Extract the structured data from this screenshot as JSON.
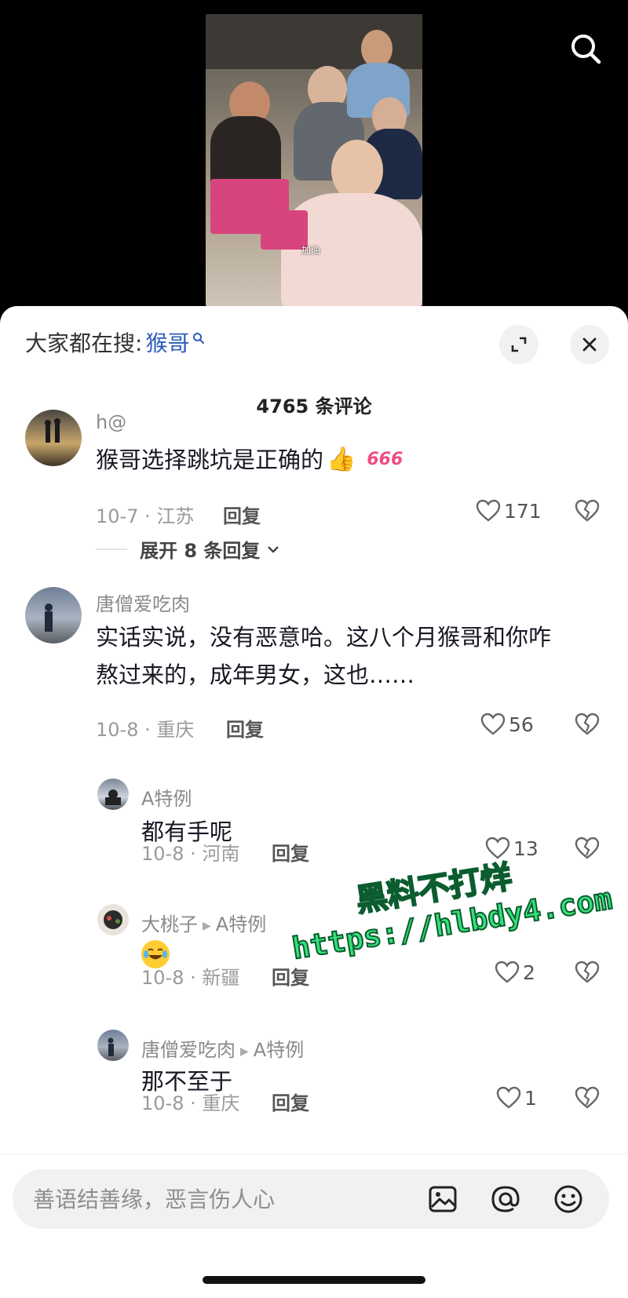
{
  "video": {
    "caption": "加油"
  },
  "header": {
    "hot_search_prefix": "大家都在搜:",
    "hot_search_keyword": "猴哥",
    "comment_count_title": "4765 条评论"
  },
  "comments": [
    {
      "username": "h@",
      "text_lines": [
        "猴哥选择跳坑是正确的"
      ],
      "emoji_tag": "666",
      "date_location": "10-7 · 江苏",
      "reply_label": "回复",
      "likes": "171",
      "expand_label": "展开 8 条回复"
    },
    {
      "username": "唐僧爱吃肉",
      "text_lines": [
        "实话实说，没有恶意哈。这八个月猴哥和你咋",
        "熬过来的，成年男女，这也……"
      ],
      "date_location": "10-8 · 重庆",
      "reply_label": "回复",
      "likes": "56"
    }
  ],
  "replies": [
    {
      "username": "A特例",
      "text": "都有手呢",
      "date_location": "10-8 · 河南",
      "reply_label": "回复",
      "likes": "13"
    },
    {
      "username": "大桃子",
      "reply_to": "A特例",
      "text": "",
      "date_location": "10-8 · 新疆",
      "reply_label": "回复",
      "likes": "2"
    },
    {
      "username": "唐僧爱吃肉",
      "reply_to": "A特例",
      "text": "那不至于",
      "date_location": "10-8 · 重庆",
      "reply_label": "回复",
      "likes": "1"
    }
  ],
  "watermark": {
    "line1": "黑料不打烊",
    "line2": "https://hlbdy4.com"
  },
  "input_bar": {
    "placeholder": "善语结善缘，恶言伤人心"
  },
  "colors": {
    "keyword_blue": "#2b5cb8",
    "watermark_green": "#35e07a",
    "sheet_bg": "#ffffff"
  },
  "icons": [
    "search-icon",
    "expand-icon",
    "close-icon",
    "heart-icon",
    "broken-heart-icon",
    "image-icon",
    "at-icon",
    "emoji-icon",
    "thumbs-up-emoji",
    "laughing-emoji"
  ]
}
